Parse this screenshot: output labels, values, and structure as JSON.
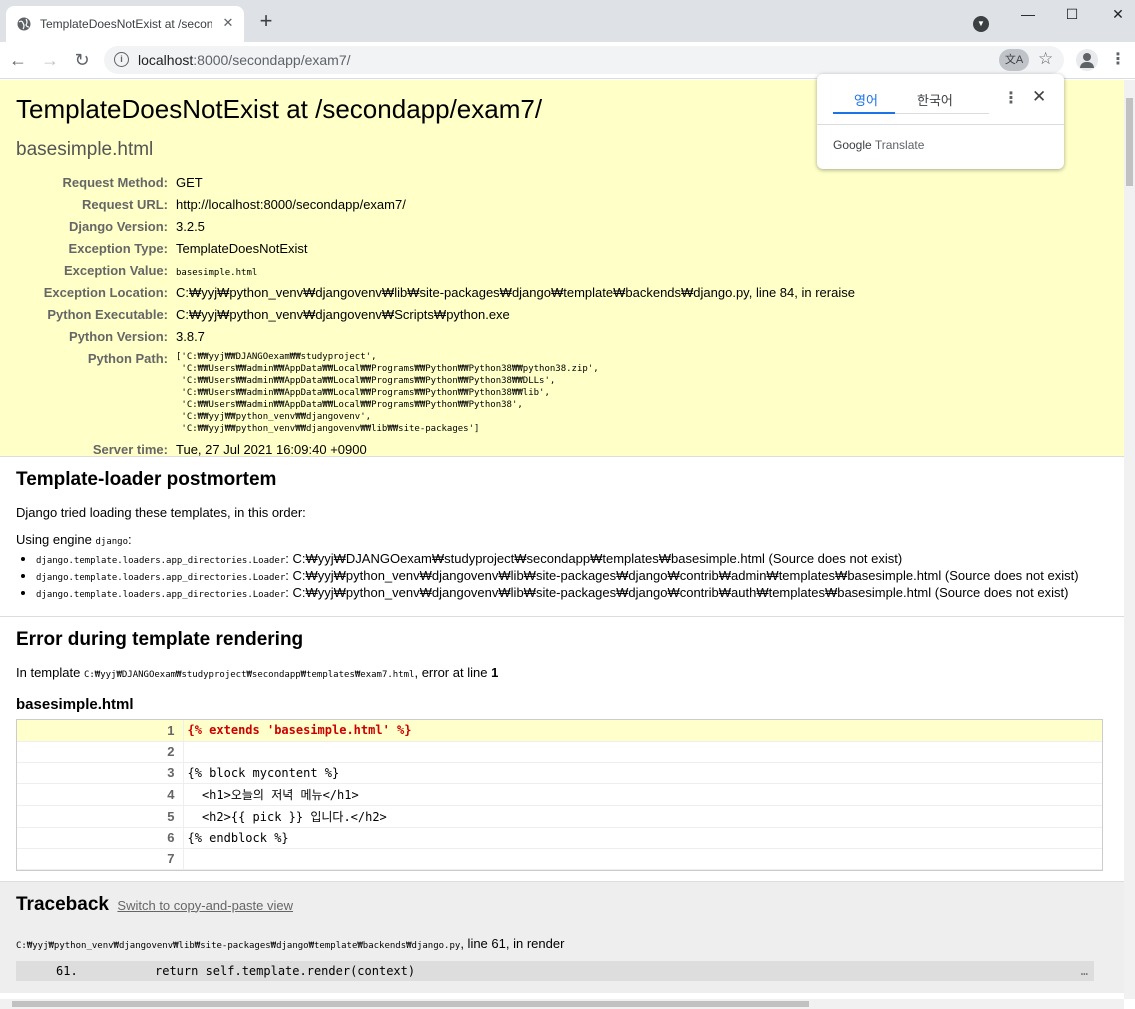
{
  "browser": {
    "tab_title": "TemplateDoesNotExist at /secondapp/exam7/",
    "new_tab_symbol": "+",
    "url_host": "localhost",
    "url_rest": ":8000/secondapp/exam7/",
    "win_min": "—",
    "win_max": "☐",
    "win_close": "✕"
  },
  "translate_popup": {
    "lang_source": "영어",
    "lang_target": "한국어",
    "brand": "Google",
    "brand_suffix": "Translate"
  },
  "summary": {
    "title": "TemplateDoesNotExist at /secondapp/exam7/",
    "subtitle": "basesimple.html",
    "rows": [
      {
        "label": "Request Method:",
        "value": "GET"
      },
      {
        "label": "Request URL:",
        "value": "http://localhost:8000/secondapp/exam7/"
      },
      {
        "label": "Django Version:",
        "value": "3.2.5"
      },
      {
        "label": "Exception Type:",
        "value": "TemplateDoesNotExist"
      },
      {
        "label": "Exception Value:",
        "value": "basesimple.html"
      },
      {
        "label": "Exception Location:",
        "value": "C:₩yyj₩python_venv₩djangovenv₩lib₩site-packages₩django₩template₩backends₩django.py, line 84, in reraise"
      },
      {
        "label": "Python Executable:",
        "value": "C:₩yyj₩python_venv₩djangovenv₩Scripts₩python.exe"
      },
      {
        "label": "Python Version:",
        "value": "3.8.7"
      },
      {
        "label": "Python Path:",
        "value": "['C:₩₩yyj₩₩DJANGOexam₩₩studyproject',\n 'C:₩₩Users₩₩admin₩₩AppData₩₩Local₩₩Programs₩₩Python₩₩Python38₩₩python38.zip',\n 'C:₩₩Users₩₩admin₩₩AppData₩₩Local₩₩Programs₩₩Python₩₩Python38₩₩DLLs',\n 'C:₩₩Users₩₩admin₩₩AppData₩₩Local₩₩Programs₩₩Python₩₩Python38₩₩lib',\n 'C:₩₩Users₩₩admin₩₩AppData₩₩Local₩₩Programs₩₩Python₩₩Python38',\n 'C:₩₩yyj₩₩python_venv₩₩djangovenv',\n 'C:₩₩yyj₩₩python_venv₩₩djangovenv₩₩lib₩₩site-packages']"
      },
      {
        "label": "Server time:",
        "value": "Tue, 27 Jul 2021 16:09:40 +0900"
      }
    ]
  },
  "postmortem": {
    "heading": "Template-loader postmortem",
    "intro": "Django tried loading these templates, in this order:",
    "engine_prefix": "Using engine ",
    "engine_name": "django",
    "engine_suffix": ":",
    "items": [
      {
        "loader": "django.template.loaders.app_directories.Loader",
        "text": ": C:₩yyj₩DJANGOexam₩studyproject₩secondapp₩templates₩basesimple.html (Source does not exist)"
      },
      {
        "loader": "django.template.loaders.app_directories.Loader",
        "text": ": C:₩yyj₩python_venv₩djangovenv₩lib₩site-packages₩django₩contrib₩admin₩templates₩basesimple.html (Source does not exist)"
      },
      {
        "loader": "django.template.loaders.app_directories.Loader",
        "text": ": C:₩yyj₩python_venv₩djangovenv₩lib₩site-packages₩django₩contrib₩auth₩templates₩basesimple.html (Source does not exist)"
      }
    ]
  },
  "render_error": {
    "heading": "Error during template rendering",
    "in_template_prefix": "In template ",
    "template_path": "C:₩yyj₩DJANGOexam₩studyproject₩secondapp₩templates₩exam7.html",
    "error_at_text": ", error at line ",
    "error_line": "1",
    "source_title": "basesimple.html",
    "lines": [
      {
        "n": "1",
        "code": "{% extends 'basesimple.html' %}"
      },
      {
        "n": "2",
        "code": ""
      },
      {
        "n": "3",
        "code": "{% block mycontent %}"
      },
      {
        "n": "4",
        "code": "  <h1>오늘의 저녁 메뉴</h1>"
      },
      {
        "n": "5",
        "code": "  <h2>{{ pick }} 입니다.</h2>"
      },
      {
        "n": "6",
        "code": "{% endblock %}"
      },
      {
        "n": "7",
        "code": ""
      }
    ]
  },
  "traceback": {
    "heading": "Traceback",
    "switch_link": "Switch to copy-and-paste view",
    "frame_file": "C:₩yyj₩python_venv₩djangovenv₩lib₩site-packages₩django₩template₩backends₩django.py",
    "frame_suffix": ", line 61, in render",
    "ctx_line_no": "61.",
    "ctx_code": "return self.template.render(context)",
    "ctx_more": "…"
  }
}
